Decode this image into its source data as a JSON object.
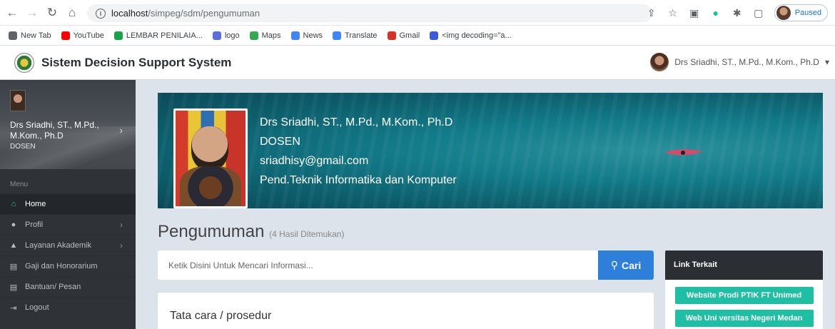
{
  "browser": {
    "url_host": "localhost",
    "url_path": "/simpeg/sdm/pengumuman",
    "profile_status": "Paused",
    "bookmarks": [
      {
        "label": "New Tab",
        "icon": "globe-icon",
        "color": "#5f6368"
      },
      {
        "label": "YouTube",
        "icon": "youtube-icon",
        "color": "#ff0000"
      },
      {
        "label": "LEMBAR PENILAIA...",
        "icon": "plus-square-icon",
        "color": "#16a34a"
      },
      {
        "label": "logo",
        "icon": "logo-icon",
        "color": "#5b6ee1"
      },
      {
        "label": "Maps",
        "icon": "map-pin-icon",
        "color": "#34a853"
      },
      {
        "label": "News",
        "icon": "news-icon",
        "color": "#4285f4"
      },
      {
        "label": "Translate",
        "icon": "translate-icon",
        "color": "#4285f4"
      },
      {
        "label": "Gmail",
        "icon": "gmail-icon",
        "color": "#d93025"
      },
      {
        "label": "<img decoding=\"a...",
        "icon": "firefox-icon",
        "color": "#3b5bdb"
      }
    ]
  },
  "app": {
    "title": "Sistem Decision Support System",
    "user_menu_name": "Drs Sriadhi, ST., M.Pd., M.Kom., Ph.D"
  },
  "sidebar": {
    "profile_name": "Drs Sriadhi, ST., M.Pd., M.Kom., Ph.D",
    "profile_role": "DOSEN",
    "menu_label": "Menu",
    "items": [
      {
        "label": "Home",
        "icon": "home-icon",
        "glyph": "⌂",
        "active": true
      },
      {
        "label": "Profil",
        "icon": "user-icon",
        "glyph": "●",
        "chevron": true
      },
      {
        "label": "Layanan Akademik",
        "icon": "graduation-cap-icon",
        "glyph": "▲",
        "chevron": true
      },
      {
        "label": "Gaji dan Honorarium",
        "icon": "document-icon",
        "glyph": "▤"
      },
      {
        "label": "Bantuan/ Pesan",
        "icon": "message-icon",
        "glyph": "▤"
      },
      {
        "label": "Logout",
        "icon": "logout-icon",
        "glyph": "⇥"
      }
    ]
  },
  "banner": {
    "name": "Drs Sriadhi, ST., M.Pd., M.Kom., Ph.D",
    "role": "DOSEN",
    "email": "sriadhisy@gmail.com",
    "department": "Pend.Teknik Informatika dan Komputer"
  },
  "main": {
    "page_title": "Pengumuman",
    "result_count": "(4 Hasil Ditemukan)",
    "search_placeholder": "Ketik Disini Untuk Mencari Informasi...",
    "search_button": "Cari",
    "card_title": "Tata cara / prosedur"
  },
  "links": {
    "header": "Link Terkait",
    "items": [
      "Website Prodi PTIK FT Unimed",
      "Web Uni versitas Negeri Medan"
    ]
  }
}
